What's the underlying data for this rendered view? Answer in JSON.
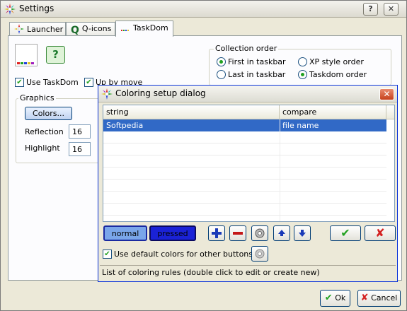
{
  "window": {
    "title": "Settings",
    "help_label": "?",
    "close_label": "✕"
  },
  "tabs": [
    {
      "label": "Launcher"
    },
    {
      "label": "Q-icons"
    },
    {
      "label": "TaskDom"
    }
  ],
  "taskdom": {
    "use_taskdom": {
      "label": "Use TaskDom",
      "checked": true
    },
    "up_by_move": {
      "label": "Up by move",
      "checked": true
    },
    "help_button": "?",
    "graphics": {
      "group_label": "Graphics",
      "colors_button": "Colors...",
      "reflection_label": "Reflection",
      "reflection_value": "16",
      "highlight_label": "Highlight",
      "highlight_value": "16"
    },
    "collection_order": {
      "group_label": "Collection order",
      "options": [
        {
          "label": "First in taskbar",
          "selected": true
        },
        {
          "label": "XP style order",
          "selected": false
        },
        {
          "label": "Last in taskbar",
          "selected": false
        },
        {
          "label": "Taskdom order",
          "selected": true
        }
      ]
    }
  },
  "dialog": {
    "title": "Coloring setup dialog",
    "close_label": "✕",
    "columns": [
      "string",
      "compare"
    ],
    "rows": [
      {
        "string": "Softpedia",
        "compare": "file name",
        "selected": true
      }
    ],
    "normal_label": "normal",
    "pressed_label": "pressed",
    "tool_icons": [
      "add-icon",
      "remove-icon",
      "settings-icon",
      "move-up-icon",
      "move-down-icon"
    ],
    "use_default": {
      "label": "Use default colors for other buttons",
      "checked": true
    },
    "status": "List of coloring rules (double click to edit or create new)",
    "accept_symbol": "✔",
    "reject_symbol": "✘"
  },
  "footer": {
    "ok_label": "Ok",
    "cancel_label": "Cancel"
  },
  "colors": {
    "normal_fill": "#7aa6ea",
    "pressed_fill": "#1a22d6",
    "selection": "#3169c6",
    "accept": "#21a121",
    "reject": "#d42020"
  }
}
